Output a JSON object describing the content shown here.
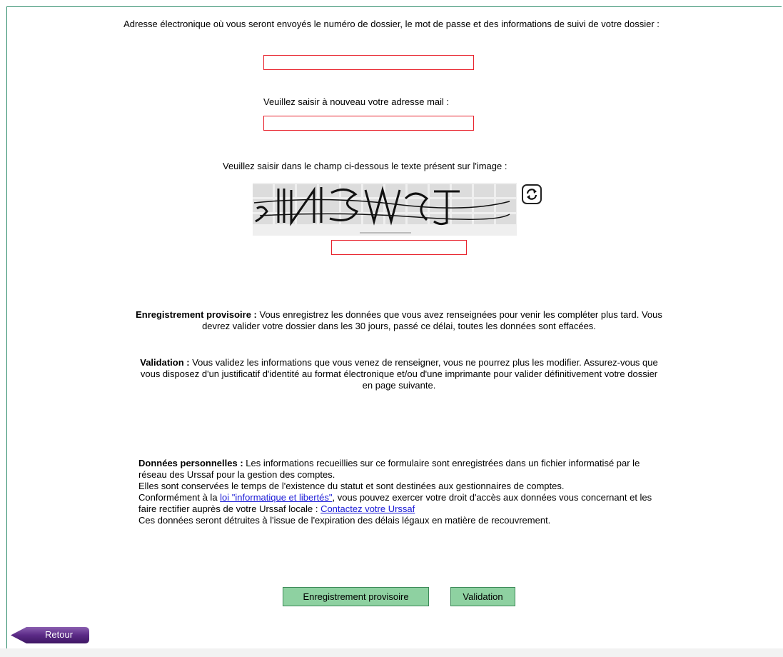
{
  "email": {
    "label": "Adresse électronique où vous seront envoyés le numéro de dossier, le mot de passe et des informations de suivi de votre dossier :",
    "value": "",
    "confirm_label": "Veuillez saisir à nouveau votre adresse mail :",
    "confirm_value": ""
  },
  "captcha": {
    "label": "Veuillez saisir dans le champ ci-dessous le texte présent sur l'image :",
    "value": "",
    "refresh_icon": "refresh-icon"
  },
  "info": {
    "provisoire_title": "Enregistrement provisoire :",
    "provisoire_text": " Vous enregistrez les données que vous avez renseignées pour venir les compléter plus tard. Vous devrez valider votre dossier dans les 30 jours, passé ce délai, toutes les données sont effacées.",
    "validation_title": "Validation :",
    "validation_text": " Vous validez les informations que vous venez de renseigner, vous ne pourrez plus les modifier. Assurez-vous que vous disposez d'un justificatif d'identité au format électronique et/ou d'une imprimante pour valider définitivement votre dossier en page suivante."
  },
  "privacy": {
    "title": "Données personnelles :",
    "text1": " Les informations recueillies sur ce formulaire sont enregistrées dans un fichier informatisé par le réseau des Urssaf pour la gestion des comptes.",
    "text2": "Elles sont conservées le temps de l'existence du statut et sont destinées aux gestionnaires de comptes.",
    "text3_before": "Conformément à la ",
    "law_link": "loi \"informatique et libertés\"",
    "text3_after": ", vous pouvez exercer votre droit d'accès aux données vous concernant et les faire rectifier auprès de votre Urssaf locale : ",
    "contact_link": "Contactez votre Urssaf",
    "text4": "Ces données seront détruites à l'issue de l'expiration des délais légaux en matière de recouvrement."
  },
  "buttons": {
    "provisoire": "Enregistrement provisoire",
    "validation": "Validation",
    "retour": "Retour"
  },
  "colors": {
    "field_border": "#e8242e",
    "button_bg": "#8ed1a1",
    "retour_bg": "#5b2a86",
    "link": "#1a1ad6"
  }
}
